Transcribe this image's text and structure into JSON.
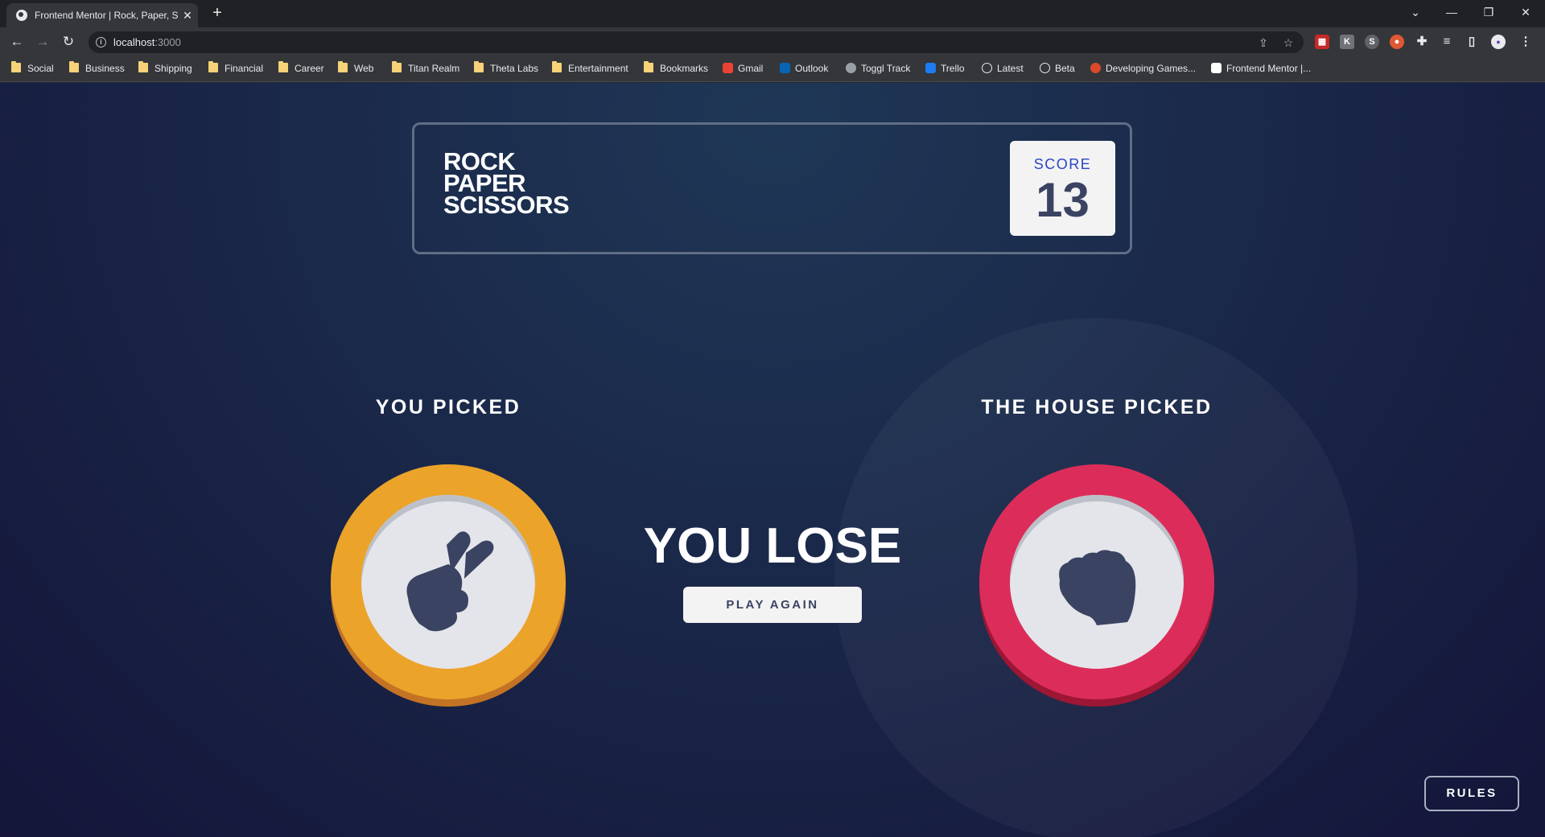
{
  "browser": {
    "tab_title": "Frontend Mentor | Rock, Paper, S",
    "url_host": "localhost",
    "url_port": ":3000",
    "bookmarks": [
      {
        "label": "Social",
        "type": "folder"
      },
      {
        "label": "Business",
        "type": "folder"
      },
      {
        "label": "Shipping",
        "type": "folder"
      },
      {
        "label": "Financial",
        "type": "folder"
      },
      {
        "label": "Career",
        "type": "folder"
      },
      {
        "label": "Web",
        "type": "folder"
      },
      {
        "label": "Titan Realm",
        "type": "folder"
      },
      {
        "label": "Theta Labs",
        "type": "folder"
      },
      {
        "label": "Entertainment",
        "type": "folder"
      },
      {
        "label": "Bookmarks",
        "type": "folder"
      },
      {
        "label": "Gmail",
        "type": "link",
        "icon": "gmail-icon",
        "color": "#ea4335"
      },
      {
        "label": "Outlook",
        "type": "link",
        "icon": "outlook-icon",
        "color": "#0a64b4"
      },
      {
        "label": "Toggl Track",
        "type": "link",
        "icon": "toggl-icon",
        "color": "#9aa0a6"
      },
      {
        "label": "Trello",
        "type": "link",
        "icon": "trello-icon",
        "color": "#1d7cf2"
      },
      {
        "label": "Latest",
        "type": "link",
        "icon": "unity-icon",
        "color": "#e8eaed"
      },
      {
        "label": "Beta",
        "type": "link",
        "icon": "unity-icon",
        "color": "#e8eaed"
      },
      {
        "label": "Developing Games...",
        "type": "link",
        "icon": "gamedev-icon",
        "color": "#d9492a"
      },
      {
        "label": "Frontend Mentor |...",
        "type": "link",
        "icon": "frontend-mentor-icon",
        "color": "#ffffff"
      }
    ]
  },
  "game": {
    "logo": [
      "ROCK",
      "PAPER",
      "SCISSORS"
    ],
    "score_label": "SCORE",
    "score": "13",
    "you_picked_label": "YOU PICKED",
    "house_picked_label": "THE HOUSE PICKED",
    "player_pick": "scissors",
    "house_pick": "rock",
    "result": "YOU LOSE",
    "play_again_label": "PLAY AGAIN",
    "rules_label": "RULES",
    "colors": {
      "scissors": "#eba32a",
      "rock": "#dc2d5a",
      "text_dark": "#3b4363",
      "score_label": "#2a46c0"
    }
  }
}
